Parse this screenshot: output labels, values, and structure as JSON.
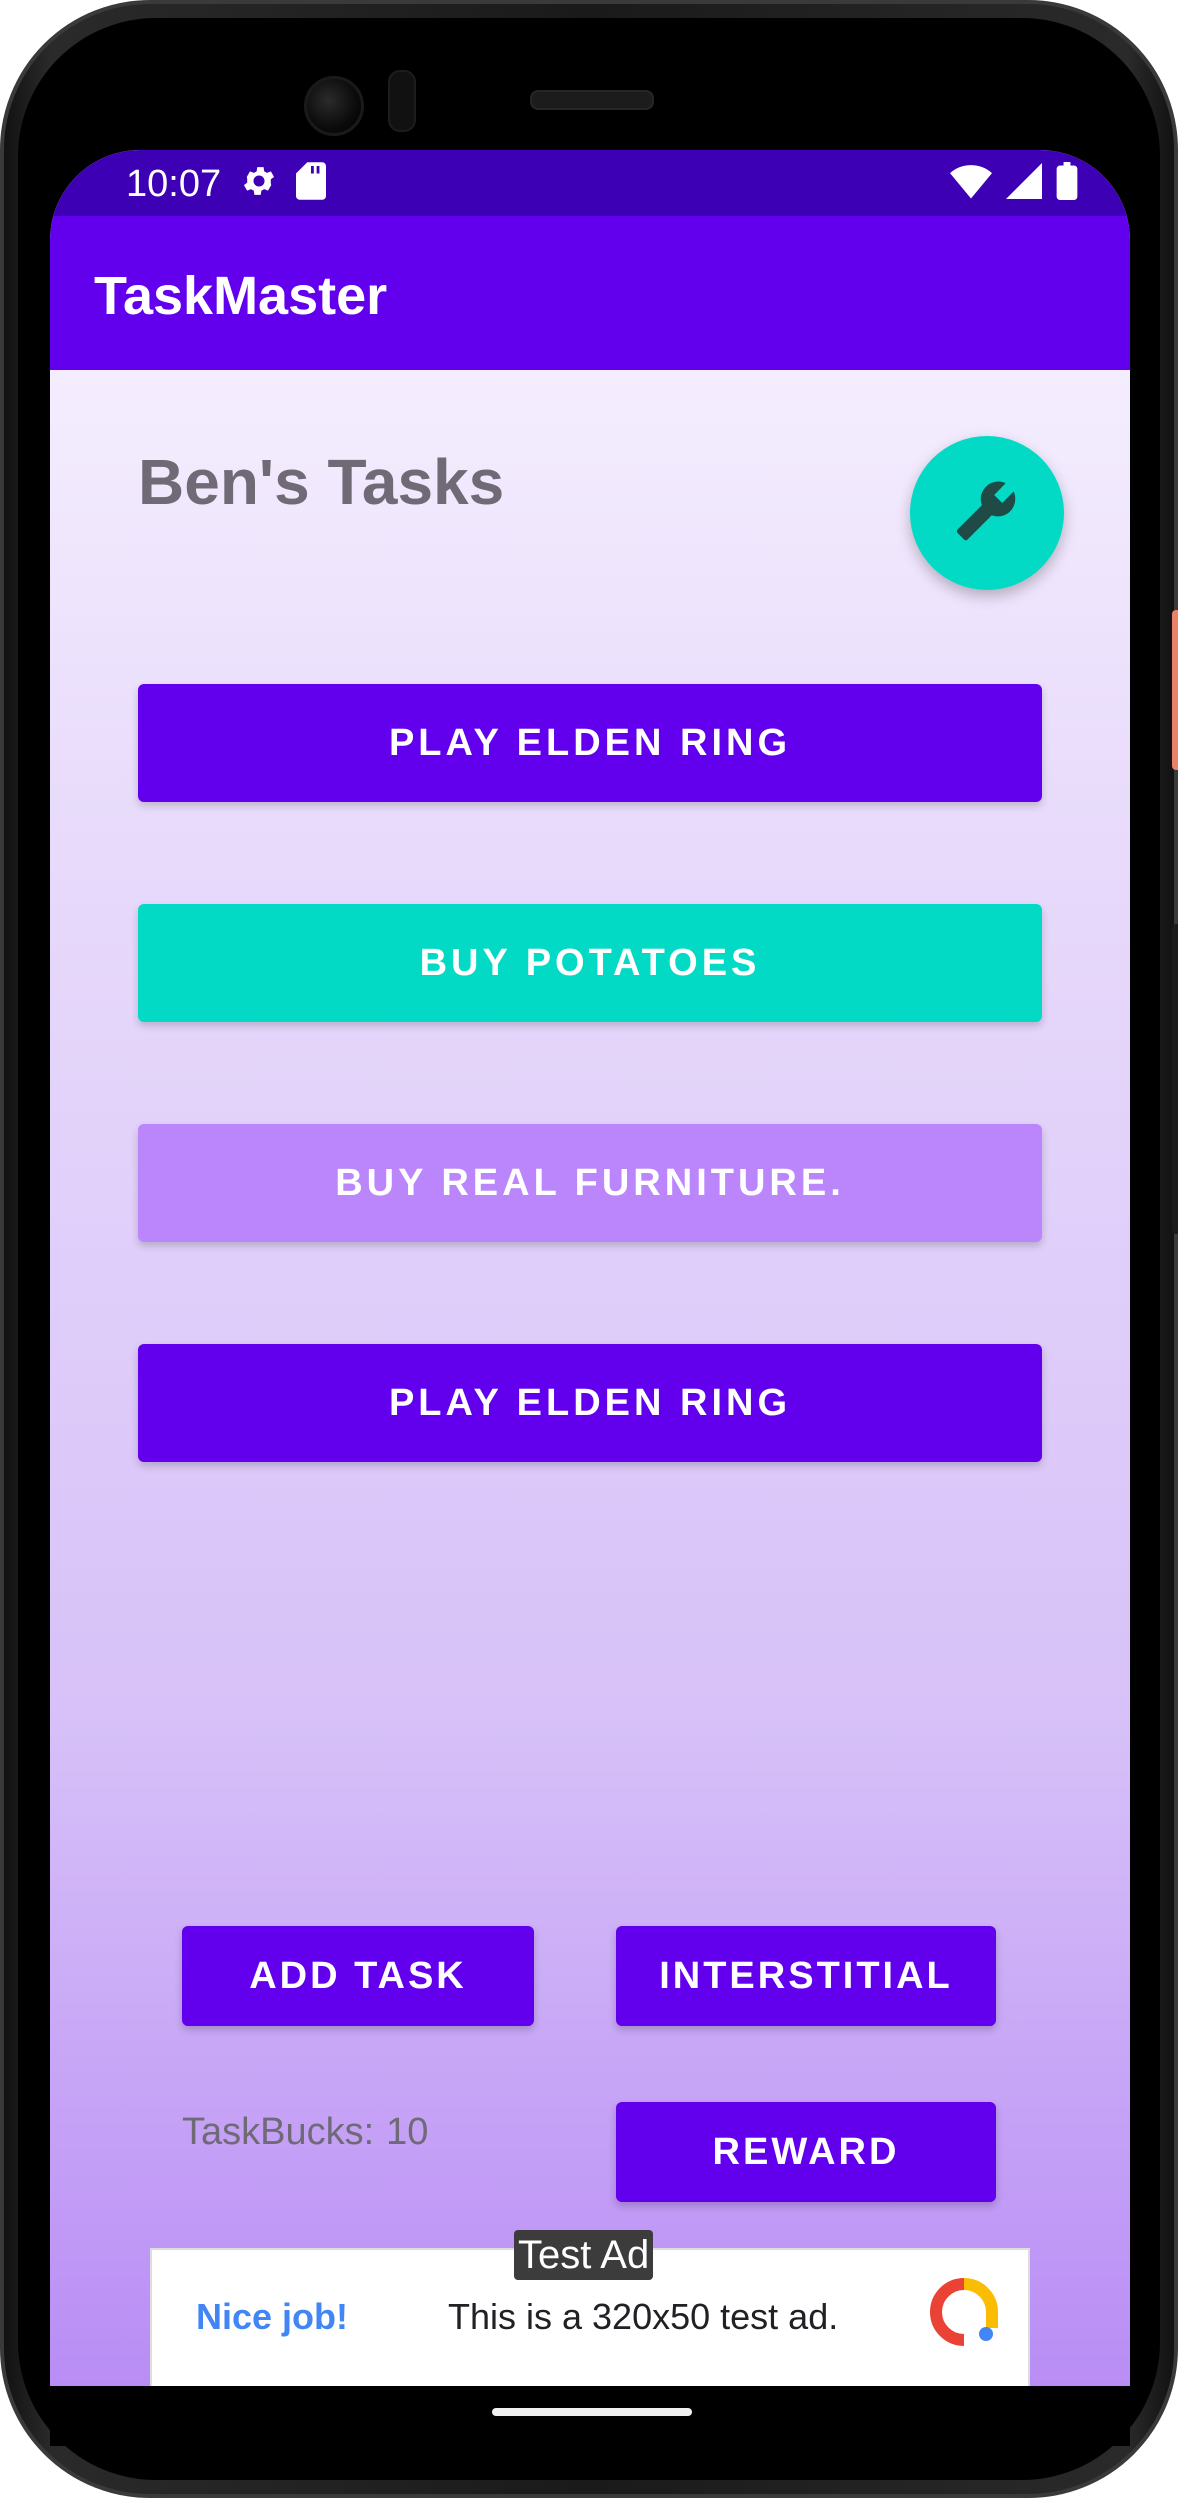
{
  "status_bar": {
    "time": "10:07",
    "left_icons": [
      "gear-icon",
      "sd-card-icon"
    ],
    "right_icons": [
      "wifi-icon",
      "signal-icon",
      "battery-icon"
    ]
  },
  "app_bar": {
    "title": "TaskMaster"
  },
  "page": {
    "title": "Ben's Tasks",
    "settings_fab_icon": "wrench-icon"
  },
  "tasks": [
    {
      "label": "PLAY ELDEN RING",
      "color": "#6200ee",
      "text_color": "#ffffff"
    },
    {
      "label": "BUY POTATOES",
      "color": "#03dac5",
      "text_color": "#ffffff"
    },
    {
      "label": "BUY REAL FURNITURE.",
      "color": "#bb86fc",
      "text_color": "#ffffff"
    },
    {
      "label": "PLAY ELDEN RING",
      "color": "#6200ee",
      "text_color": "#ffffff"
    }
  ],
  "actions": {
    "add_task": "ADD TASK",
    "interstitial": "INTERSTITIAL",
    "reward": "REWARD"
  },
  "taskbucks": {
    "label": "TaskBucks:",
    "value": "10"
  },
  "ad": {
    "badge": "Test Ad",
    "headline": "Nice job!",
    "body": "This is a 320x50 test ad.",
    "logo_icon": "admob-logo-icon"
  },
  "colors": {
    "primary": "#6200ee",
    "primary_dark": "#3d00b5",
    "secondary": "#03dac5",
    "light_purple": "#bb86fc"
  }
}
